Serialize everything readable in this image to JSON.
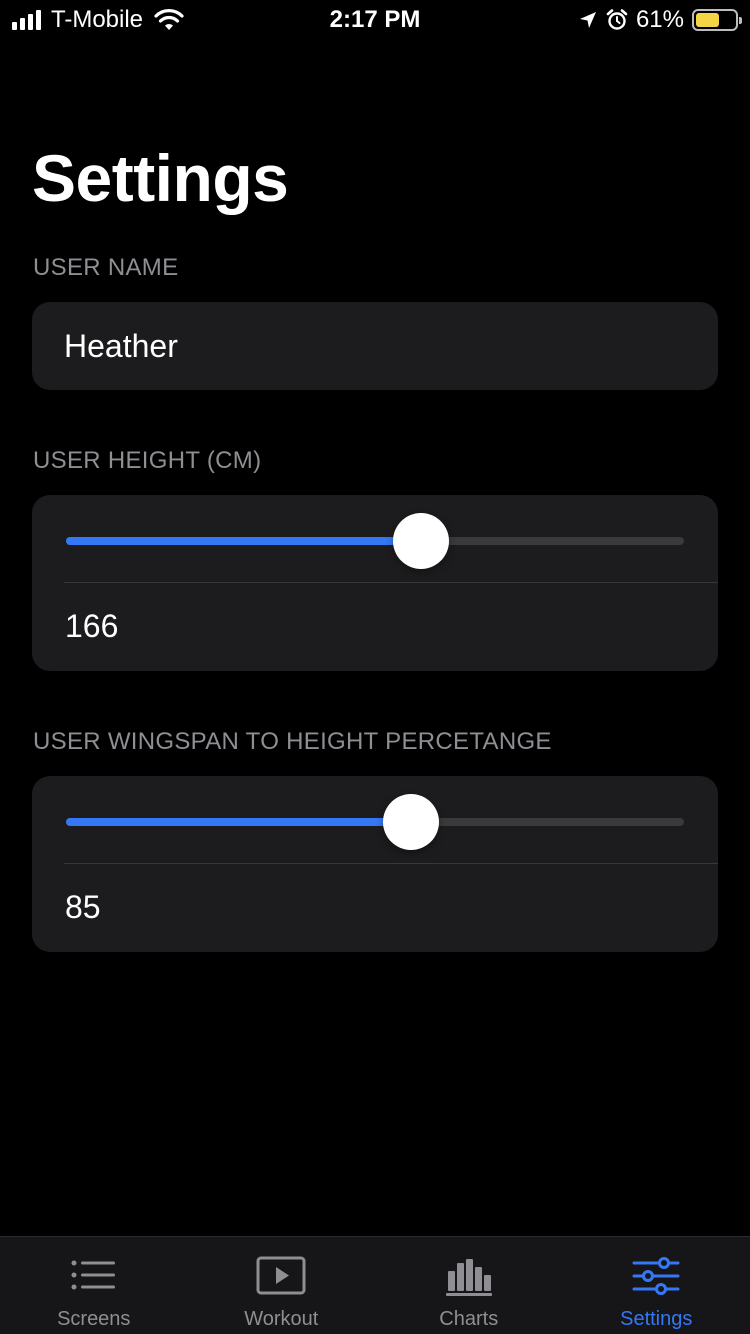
{
  "status_bar": {
    "carrier": "T-Mobile",
    "time": "2:17 PM",
    "battery_percent": "61%",
    "battery_level": 0.61,
    "icons": [
      "signal-icon",
      "wifi-icon",
      "location-icon",
      "alarm-icon",
      "battery-icon"
    ]
  },
  "page": {
    "title": "Settings"
  },
  "user_name": {
    "label": "USER NAME",
    "value": "Heather"
  },
  "user_height": {
    "label": "USER HEIGHT (CM)",
    "value": "166",
    "slider_fraction": 0.574
  },
  "wingspan": {
    "label": "USER WINGSPAN TO HEIGHT PERCETANGE",
    "value": "85",
    "slider_fraction": 0.558
  },
  "colors": {
    "accent": "#3478f6",
    "background": "#000000",
    "card": "#1c1c1e",
    "secondary_text": "#8e8e93"
  },
  "tab_bar": {
    "tabs": [
      {
        "label": "Screens",
        "icon": "list-icon",
        "active": false
      },
      {
        "label": "Workout",
        "icon": "play-icon",
        "active": false
      },
      {
        "label": "Charts",
        "icon": "bar-chart-icon",
        "active": false
      },
      {
        "label": "Settings",
        "icon": "sliders-icon",
        "active": true
      }
    ]
  }
}
